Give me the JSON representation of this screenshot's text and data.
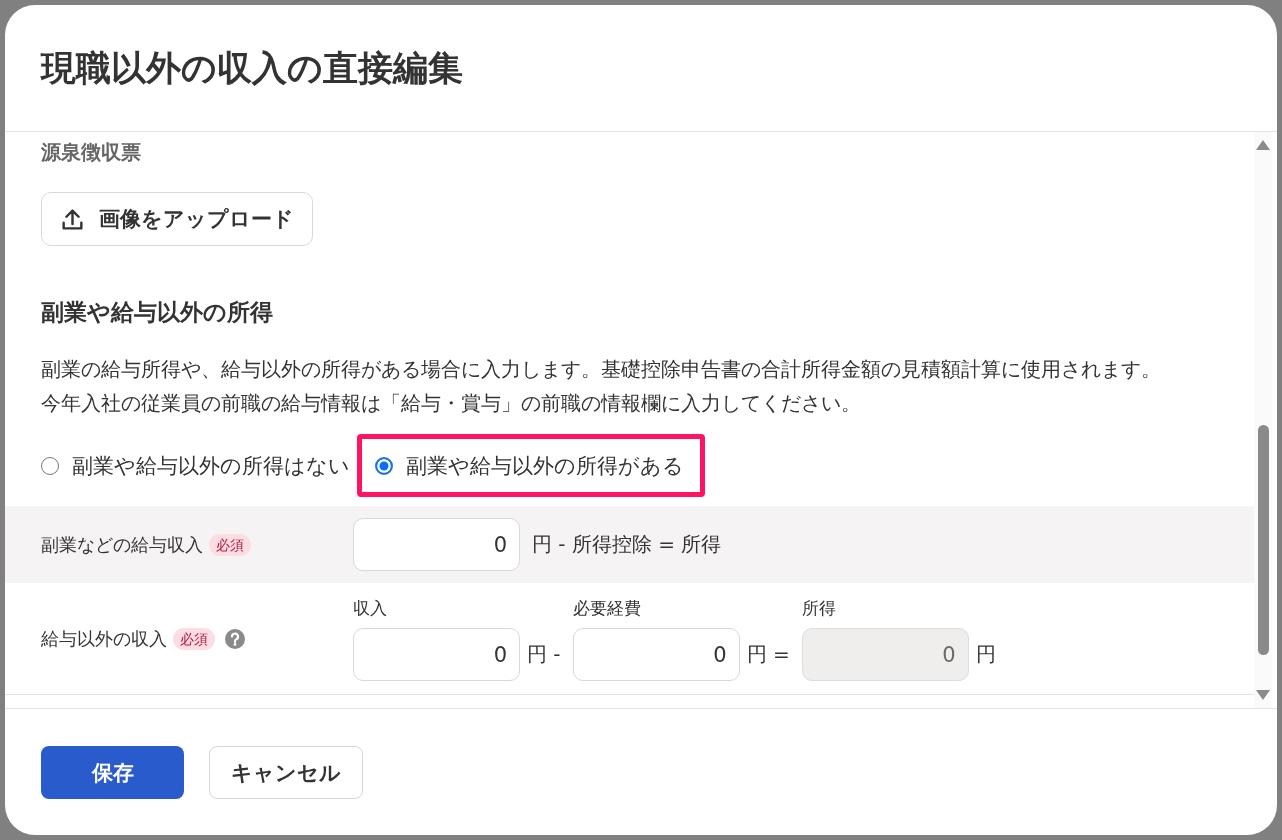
{
  "dialog": {
    "title": "現職以外の収入の直接編集"
  },
  "withholding_slip": {
    "label": "源泉徴収票",
    "upload_button": "画像をアップロード"
  },
  "side_income": {
    "heading": "副業や給与以外の所得",
    "description": [
      "副業の給与所得や、給与以外の所得がある場合に入力します。基礎控除申告書の合計所得金額の見積額計算に使用されます。",
      "今年入社の従業員の前職の給与情報は「給与・賞与」の前職の情報欄に入力してください。"
    ],
    "options": [
      {
        "label": "副業や給与以外の所得はない",
        "selected": false,
        "highlighted": false
      },
      {
        "label": "副業や給与以外の所得がある",
        "selected": true,
        "highlighted": true
      }
    ],
    "rows": [
      {
        "kind": "single",
        "label": "副業などの給与収入",
        "badge": "必須",
        "help": false,
        "value": "0",
        "formula": "円 - 所得控除 = 所得"
      },
      {
        "kind": "calculation",
        "label": "給与以外の収入",
        "badge": "必須",
        "help": true,
        "fields": [
          {
            "label": "収入",
            "value": "0",
            "unit": "円 -",
            "disabled": false
          },
          {
            "label": "必要経費",
            "value": "0",
            "unit": "円 =",
            "disabled": false
          },
          {
            "label": "所得",
            "value": "0",
            "unit": "円",
            "disabled": true
          }
        ]
      }
    ]
  },
  "footer": {
    "buttons": [
      {
        "label": "保存",
        "kind": "primary"
      },
      {
        "label": "キャンセル",
        "kind": "secondary"
      }
    ]
  }
}
